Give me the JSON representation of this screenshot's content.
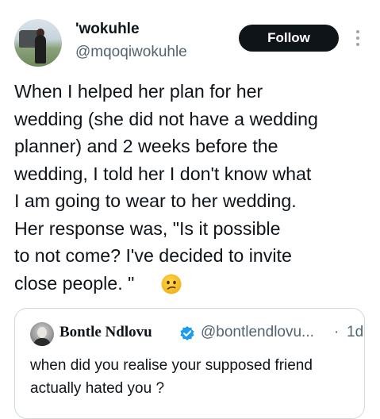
{
  "author": {
    "display_name": "'wokuhle",
    "handle": "@mqoqiwokuhle"
  },
  "follow_label": "Follow",
  "tweet": {
    "text": "When I helped her plan for her\nwedding (she did not have a wedding\nplanner) and 2 weeks before the\nwedding, I told her I don't know what\nI am going to wear to her wedding.\nHer response was, \"Is it possible\nto not come? I've decided to invite\nclose people. \"",
    "emoji": "confused-face-emoji"
  },
  "quoted": {
    "display_name": "Bontle Ndlovu",
    "handle": "@bontlendlovu...",
    "separator": "·",
    "time": "1d",
    "text": "when did you realise your supposed friend\nactually hated you ?"
  },
  "colors": {
    "follow_bg": "#0f1419",
    "secondary_text": "#536471",
    "verified": "#1d9bf0",
    "card_border": "#cfd9de"
  }
}
